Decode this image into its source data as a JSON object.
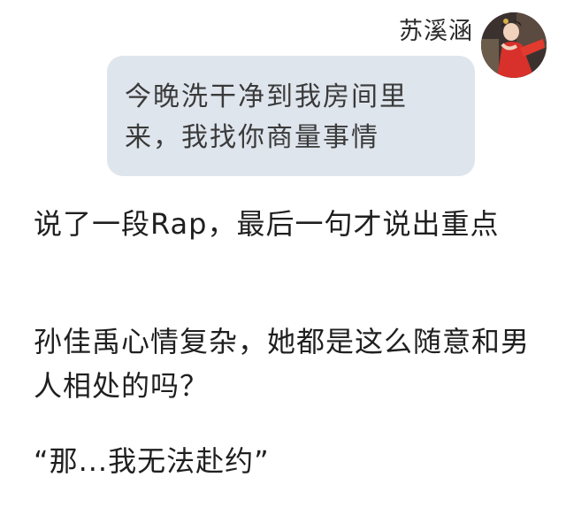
{
  "chat": {
    "sender_name": "苏溪涵",
    "avatar_icon": "profile-photo",
    "message": "今晚洗干净到我房间里来，我找你商量事情",
    "bubble_color": "#dfe5ed"
  },
  "article": {
    "paragraphs": [
      "说了一段Rap，最后一句才说出重点",
      "孙佳禹心情复杂，她都是这么随意和男人相处的吗？",
      "“那...我无法赴约”"
    ]
  }
}
